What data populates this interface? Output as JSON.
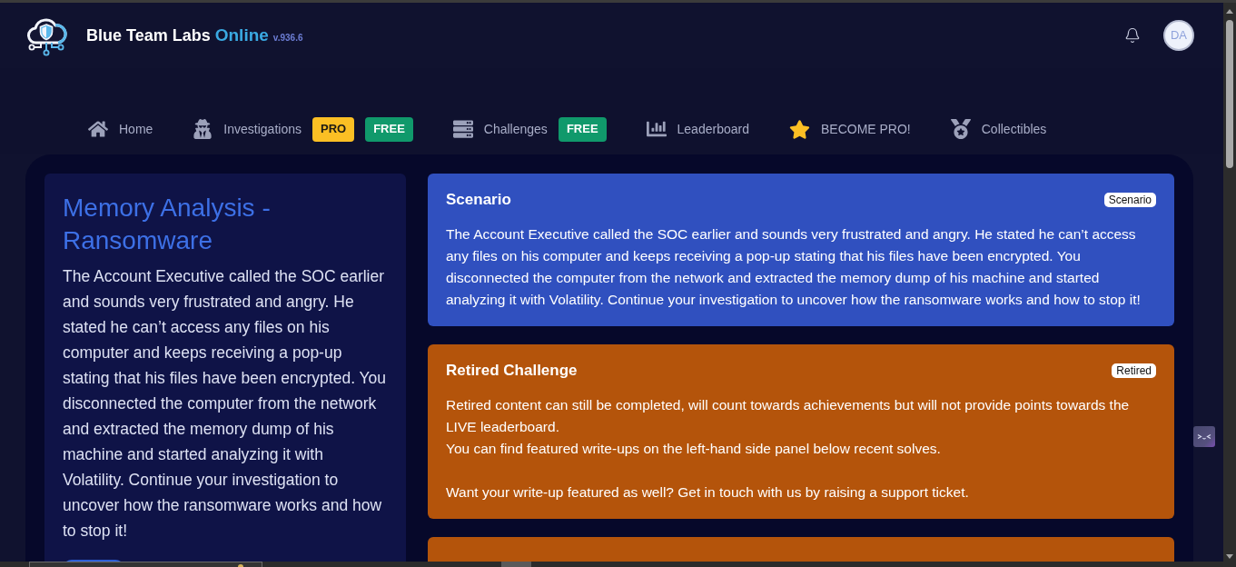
{
  "header": {
    "brand": {
      "name": "Blue Team Labs",
      "accent": "Online",
      "version": "v.936.6"
    },
    "avatar": {
      "initials": "DA"
    }
  },
  "nav": [
    {
      "label": "Home"
    },
    {
      "label": "Investigations",
      "badges": [
        {
          "text": "PRO",
          "color": "#fbbf24"
        },
        {
          "text": "FREE",
          "color": "#10996b"
        }
      ]
    },
    {
      "label": "Challenges",
      "badges": [
        {
          "text": "FREE",
          "color": "#10996b"
        }
      ]
    },
    {
      "label": "Leaderboard"
    },
    {
      "label": "BECOME PRO!"
    },
    {
      "label": "Collectibles"
    }
  ],
  "challenge": {
    "title": "Memory Analysis - Ransomware",
    "description": "The Account Executive called the SOC earlier and sounds very frustrated and angry. He stated he can’t access any files on his computer and keeps receiving a pop-up stating that his files have been encrypted. You disconnected the computer from the network and extracted the memory dump of his machine and started analyzing it with Volatility. Continue your investigation to uncover how the ransomware works and how to stop it!"
  },
  "cards": [
    {
      "title": "Scenario",
      "tag": "Scenario",
      "color": "#3050bf",
      "paragraphs": [
        [
          "The Account Executive called the SOC earlier and sounds very frustrated and angry. He stated he can’t access any files on his computer and keeps receiving a pop-up stating that his files have been encrypted. You disconnected the computer from the network and extracted the memory dump of his machine and started analyzing it with Volatility. Continue your investigation to uncover how the ransomware works and how to stop it!"
        ]
      ]
    },
    {
      "title": "Retired Challenge",
      "tag": "Retired",
      "color": "#b4540b",
      "paragraphs": [
        [
          "Retired content can still be completed, will count towards achievements but will not provide points towards the LIVE leaderboard.",
          "You can find featured write-ups on the left-hand side panel below recent solves."
        ],
        [
          "Want your write-up featured as well? Get in touch with us by raising a support ticket."
        ]
      ]
    },
    {
      "color": "#b4540b"
    }
  ]
}
